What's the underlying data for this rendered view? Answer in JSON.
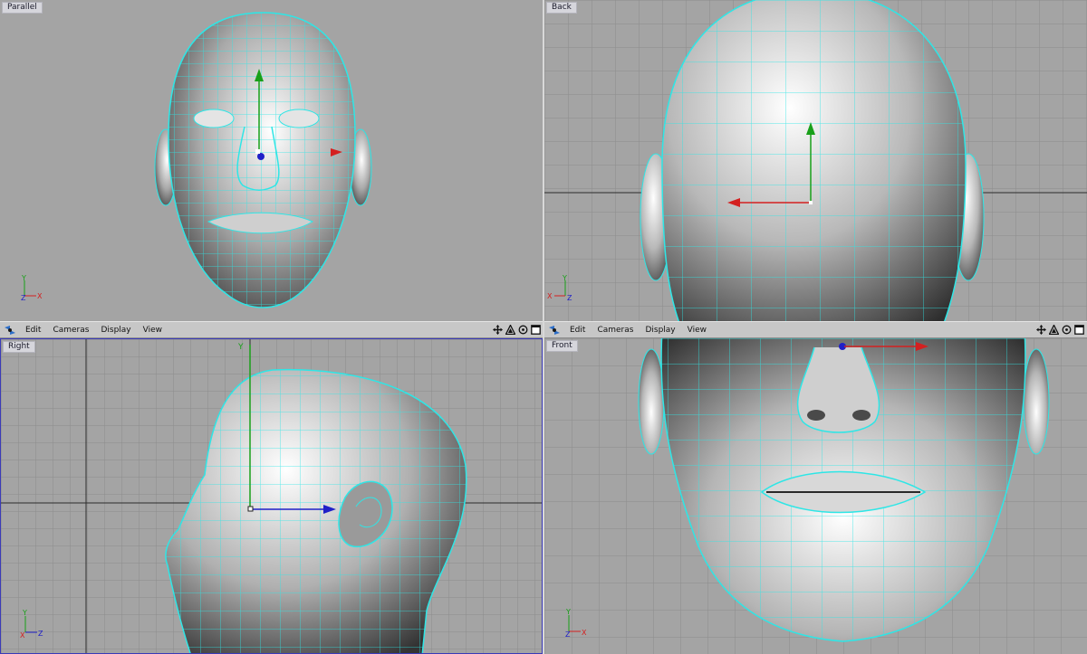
{
  "viewports": {
    "parallel": {
      "label": "Parallel"
    },
    "back": {
      "label": "Back"
    },
    "right": {
      "label": "Right"
    },
    "front": {
      "label": "Front"
    }
  },
  "axes": {
    "x": "X",
    "y": "Y",
    "z": "Z"
  },
  "menu": {
    "edit": "Edit",
    "cameras": "Cameras",
    "display": "Display",
    "view": "View"
  },
  "icons": {
    "app": "cinema4d-icon",
    "move": "move-view-icon",
    "zoom": "zoom-view-icon",
    "rotate": "rotate-view-icon",
    "maximize": "maximize-view-icon"
  },
  "colors": {
    "viewport_bg": "#a4a4a4",
    "grid": "#8c8c8c",
    "wire": "#2ee6e6",
    "axis_x": "#d42020",
    "axis_y": "#19a019",
    "axis_z": "#2020c8",
    "active_border": "#3b3bb8"
  }
}
